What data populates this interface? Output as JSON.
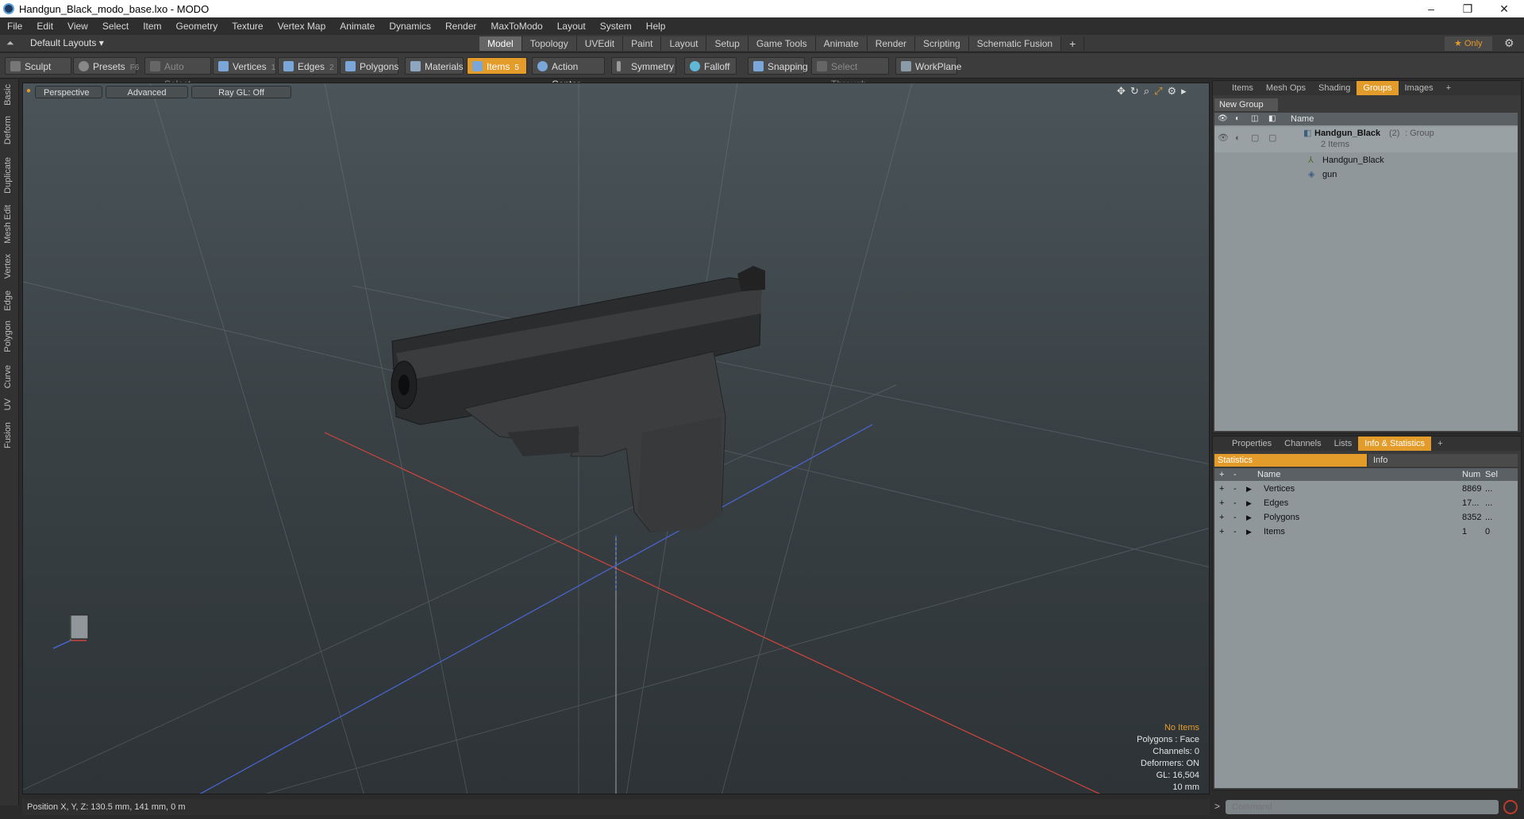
{
  "window": {
    "title": "Handgun_Black_modo_base.lxo - MODO",
    "minimize": "–",
    "maximize": "❐",
    "close": "✕"
  },
  "menu": [
    "File",
    "Edit",
    "View",
    "Select",
    "Item",
    "Geometry",
    "Texture",
    "Vertex Map",
    "Animate",
    "Dynamics",
    "Render",
    "MaxToModo",
    "Layout",
    "System",
    "Help"
  ],
  "layout_bar": {
    "layouts_label": "Default Layouts ▾",
    "tabs": [
      "Model",
      "Topology",
      "UVEdit",
      "Paint",
      "Layout",
      "Setup",
      "Game Tools",
      "Animate",
      "Render",
      "Scripting",
      "Schematic Fusion"
    ],
    "active_tab": "Model",
    "add": "+",
    "only_label": "★  Only",
    "gear": "⚙"
  },
  "toolbar": {
    "sculpt": "Sculpt",
    "presets": "Presets",
    "presets_key": "F6",
    "auto_select": "Auto Select",
    "vertices": "Vertices",
    "vertices_key": "1",
    "edges": "Edges",
    "edges_key": "2",
    "polygons": "Polygons",
    "materials": "Materials",
    "items": "Items",
    "items_key": "5",
    "action_center": "Action Center",
    "symmetry": "Symmetry",
    "falloff": "Falloff",
    "snapping": "Snapping",
    "select_through": "Select Through",
    "workplane": "WorkPlane"
  },
  "left_tabs": [
    "Basic",
    "Deform",
    "Duplicate",
    "Mesh Edit",
    "Vertex",
    "Edge",
    "Polygon",
    "Curve",
    "UV",
    "Fusion"
  ],
  "viewport": {
    "perspective": "Perspective",
    "advanced": "Advanced",
    "raygl": "Ray GL: Off",
    "hud": {
      "no_items": "No Items",
      "polygons": "Polygons : Face",
      "channels": "Channels: 0",
      "deformers": "Deformers: ON",
      "gl": "GL: 16,504",
      "scale": "10 mm"
    }
  },
  "status": {
    "position": "Position X, Y, Z:   130.5 mm, 141 mm, 0 m"
  },
  "groups_panel": {
    "tabs": [
      "Items",
      "Mesh Ops",
      "Shading",
      "Groups",
      "Images"
    ],
    "active_tab": "Groups",
    "add": "+",
    "new_group": "New Group",
    "col_name": "Name",
    "group": {
      "name": "Handgun_Black",
      "count": "(2)",
      "type": ": Group",
      "sub": "2 Items"
    },
    "children": [
      "Handgun_Black",
      "gun"
    ]
  },
  "stats_panel": {
    "tabs": [
      "Properties",
      "Channels",
      "Lists",
      "Info & Statistics"
    ],
    "active_tab": "Info & Statistics",
    "add": "+",
    "subtabs": [
      "Statistics",
      "Info"
    ],
    "cols": {
      "name": "Name",
      "num": "Num",
      "sel": "Sel"
    },
    "rows": [
      {
        "name": "Vertices",
        "num": "8869",
        "sel": "..."
      },
      {
        "name": "Edges",
        "num": "17...",
        "sel": "..."
      },
      {
        "name": "Polygons",
        "num": "8352",
        "sel": "..."
      },
      {
        "name": "Items",
        "num": "1",
        "sel": "0"
      }
    ]
  },
  "command": {
    "placeholder": "Command",
    "prompt": ">"
  },
  "colors": {
    "accent": "#e39b2a",
    "x_axis": "#d0453c",
    "z_axis": "#4a67d8",
    "y_axis": "#5fc25f"
  }
}
